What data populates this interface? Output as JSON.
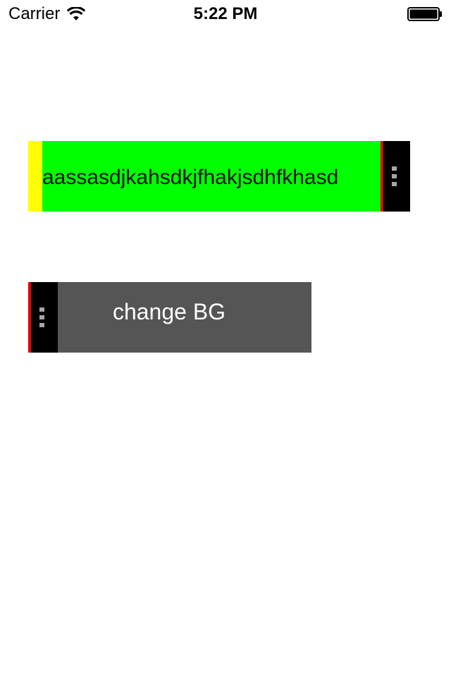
{
  "status_bar": {
    "carrier": "Carrier",
    "time": "5:22 PM",
    "icons": [
      "wifi-icon",
      "battery-icon"
    ]
  },
  "text_field": {
    "value": "aassasdjkahsdkjfhakjsdhfkhasd",
    "handle_icon": "grip-icon"
  },
  "button": {
    "label": "change BG",
    "handle_icon": "grip-icon"
  },
  "colors": {
    "yellow_strip": "#ffff00",
    "text_field_bg": "#00ff00",
    "handle_bg": "#000000",
    "handle_edge": "#e60000",
    "button_bg": "#555555",
    "button_text": "#ffffff"
  }
}
